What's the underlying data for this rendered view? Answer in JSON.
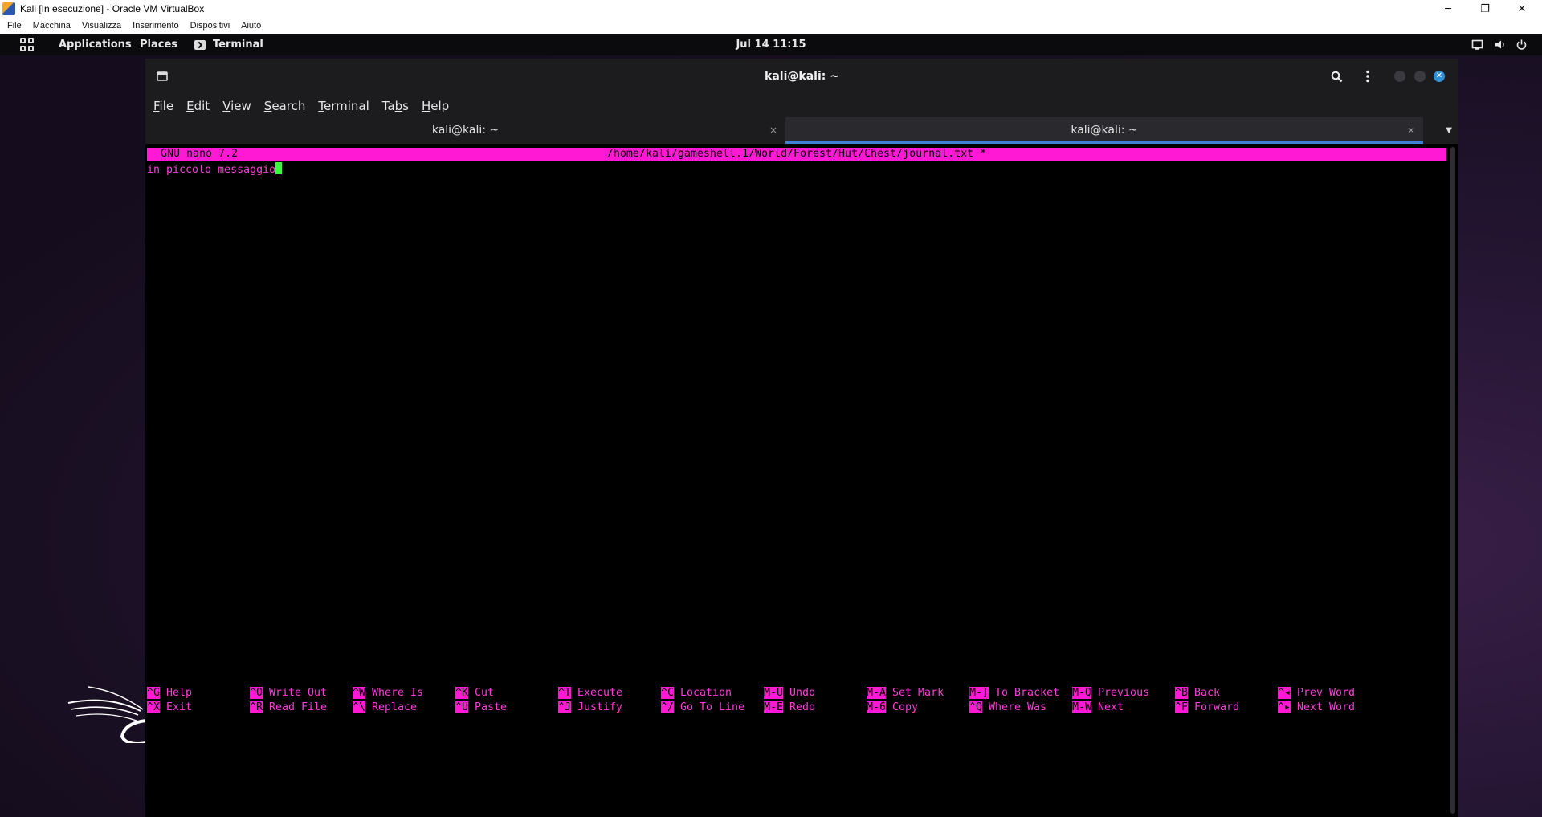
{
  "host": {
    "title": "Kali [In esecuzione] - Oracle VM VirtualBox",
    "window_controls": {
      "minimize": "─",
      "restore": "❐",
      "close": "✕"
    },
    "menu": [
      "File",
      "Macchina",
      "Visualizza",
      "Inserimento",
      "Dispositivi",
      "Aiuto"
    ]
  },
  "topbar": {
    "applications": "Applications",
    "places": "Places",
    "active_app": "Terminal",
    "clock": "Jul 14  11:15",
    "tray_icons": [
      "screen-icon",
      "volume-icon",
      "power-icon"
    ]
  },
  "terminal": {
    "title": "kali@kali: ~",
    "menu": [
      {
        "pre": "",
        "u": "F",
        "post": "ile"
      },
      {
        "pre": "",
        "u": "E",
        "post": "dit"
      },
      {
        "pre": "",
        "u": "V",
        "post": "iew"
      },
      {
        "pre": "",
        "u": "S",
        "post": "earch"
      },
      {
        "pre": "",
        "u": "T",
        "post": "erminal"
      },
      {
        "pre": "Ta",
        "u": "b",
        "post": "s"
      },
      {
        "pre": "",
        "u": "H",
        "post": "elp"
      }
    ],
    "tabs": [
      {
        "label": "kali@kali: ~",
        "close": "×",
        "active": false
      },
      {
        "label": "kali@kali: ~",
        "close": "×",
        "active": true
      }
    ],
    "tab_dropdown": "▼",
    "accent_color": "#3f7fd6"
  },
  "nano": {
    "version": "GNU nano 7.2",
    "path": "/home/kali/gameshell.1/World/Forest/Hut/Chest/journal.txt *",
    "content": "in piccolo messaggio",
    "highlight_color": "#ff19d5",
    "cursor_color": "#36ff36",
    "shortcuts_row1": [
      {
        "key": "^G",
        "label": "Help"
      },
      {
        "key": "^O",
        "label": "Write Out"
      },
      {
        "key": "^W",
        "label": "Where Is"
      },
      {
        "key": "^K",
        "label": "Cut"
      },
      {
        "key": "^T",
        "label": "Execute"
      },
      {
        "key": "^C",
        "label": "Location"
      },
      {
        "key": "M-U",
        "label": "Undo"
      },
      {
        "key": "M-A",
        "label": "Set Mark"
      },
      {
        "key": "M-]",
        "label": "To Bracket"
      },
      {
        "key": "M-Q",
        "label": "Previous"
      },
      {
        "key": "^B",
        "label": "Back"
      },
      {
        "key": "^◂",
        "label": "Prev Word"
      }
    ],
    "shortcuts_row2": [
      {
        "key": "^X",
        "label": "Exit"
      },
      {
        "key": "^R",
        "label": "Read File"
      },
      {
        "key": "^\\",
        "label": "Replace"
      },
      {
        "key": "^U",
        "label": "Paste"
      },
      {
        "key": "^J",
        "label": "Justify"
      },
      {
        "key": "^/",
        "label": "Go To Line"
      },
      {
        "key": "M-E",
        "label": "Redo"
      },
      {
        "key": "M-6",
        "label": "Copy"
      },
      {
        "key": "^Q",
        "label": "Where Was"
      },
      {
        "key": "M-W",
        "label": "Next"
      },
      {
        "key": "^F",
        "label": "Forward"
      },
      {
        "key": "^▸",
        "label": "Next Word"
      }
    ]
  }
}
